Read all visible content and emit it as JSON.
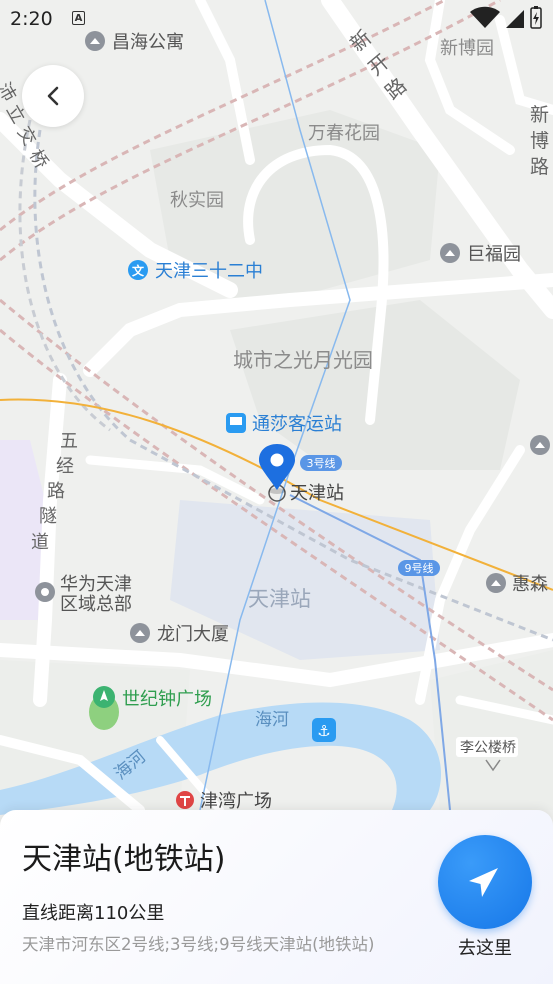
{
  "status_bar": {
    "time": "2:20",
    "notification_glyph": "A"
  },
  "map": {
    "pois": {
      "changhai": "昌海公寓",
      "xinbo": "新博园",
      "wanchun": "万春花园",
      "qiushi": "秋实园",
      "jufu": "巨福园",
      "school": "天津三十二中",
      "city_light": "城市之光月光园",
      "tongsha": "通莎客运站",
      "station": "天津站",
      "station_area": "天津站",
      "huawei_1": "华为天津",
      "huawei_2": "区域总部",
      "longmen": "龙门大厦",
      "century": "世纪钟广场",
      "jinwan": "津湾广场",
      "hui": "惠森",
      "ligonglou": "李公楼桥",
      "river_east": "海河",
      "river_west": "海河"
    },
    "roads": {
      "xinkai": [
        "新",
        "开",
        "路"
      ],
      "xinbo_road": [
        "新",
        "博",
        "路"
      ],
      "wujing": [
        "五",
        "经",
        "路",
        "隧",
        "道"
      ],
      "overpass": [
        "沛",
        "立",
        "交",
        "桥"
      ]
    },
    "line_badges": {
      "line3": "3号线",
      "line9": "9号线"
    }
  },
  "sheet": {
    "title": "天津站(地铁站)",
    "distance": "直线距离110公里",
    "address": "天津市河东区2号线;3号线;9号线天津站(地铁站)",
    "go_label": "去这里"
  }
}
